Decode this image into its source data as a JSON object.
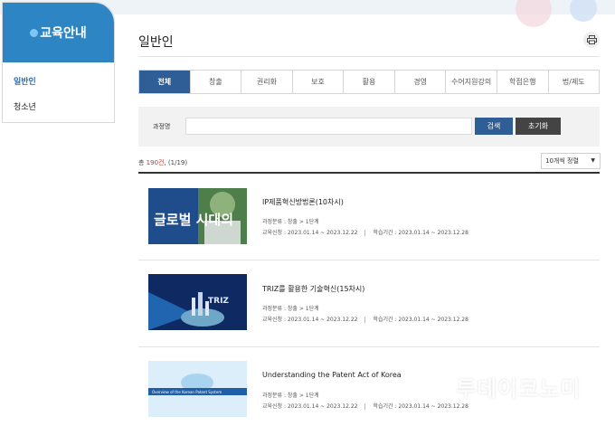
{
  "sidebar": {
    "title": "교육안내",
    "items": [
      {
        "label": "일반인",
        "active": true
      },
      {
        "label": "청소년",
        "active": false
      }
    ]
  },
  "page": {
    "title": "일반인",
    "print_icon": "printer-icon"
  },
  "tabs": [
    {
      "label": "전체",
      "active": true
    },
    {
      "label": "창출"
    },
    {
      "label": "권리화"
    },
    {
      "label": "보호"
    },
    {
      "label": "활용"
    },
    {
      "label": "경영"
    },
    {
      "label": "수어지원강의"
    },
    {
      "label": "학점은행"
    },
    {
      "label": "법/제도"
    }
  ],
  "search": {
    "label": "과정명",
    "value": "",
    "placeholder": "",
    "search_button": "검색",
    "reset_button": "초기화"
  },
  "list": {
    "count_prefix": "총 ",
    "count_number": "190건",
    "count_suffix": ", (1/19)",
    "per_page": "10개씩 정렬"
  },
  "courses": [
    {
      "title": "IP제품혁신방법론(10차시)",
      "category": "과정분류 : 창출 > 1단계",
      "apply": "교육신청 : 2023.01.14 ~ 2023.12.22",
      "study": "학습기간 : 2023.01.14 ~ 2023.12.28",
      "thumb_text": "글로벌 시대의"
    },
    {
      "title": "TRIZ를 활용한 기술혁신(15차시)",
      "category": "과정분류 : 창출 > 1단계",
      "apply": "교육신청 : 2023.01.14 ~ 2023.12.22",
      "study": "학습기간 : 2023.01.14 ~ 2023.12.28",
      "thumb_text": "TRIZ"
    },
    {
      "title": "Understanding the Patent Act of Korea",
      "category": "과정분류 : 창출 > 1단계",
      "apply": "교육신청 : 2023.01.14 ~ 2023.12.22",
      "study": "학습기간 : 2023.01.14 ~ 2023.12.28",
      "thumb_text": "Overview of the Korean Patent System"
    }
  ],
  "watermark": "투데이코노미",
  "colors": {
    "accent": "#2f5d96",
    "sidebar": "#2d86c3",
    "count": "#c0392b"
  }
}
